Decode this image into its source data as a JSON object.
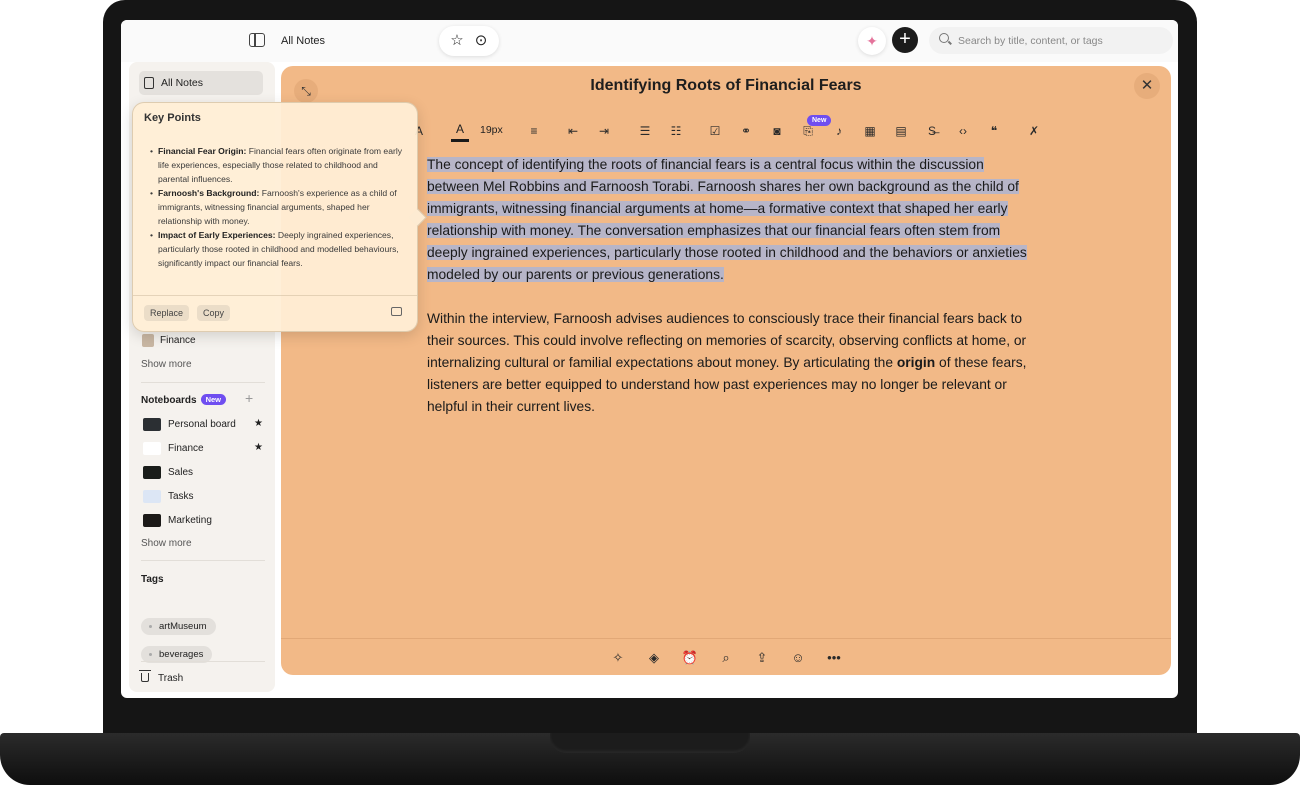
{
  "topbar": {
    "title": "All Notes",
    "search_placeholder": "Search by title, content, or tags",
    "plus_glyph": "+"
  },
  "sidebar": {
    "all_notes": "All Notes",
    "finance_note": "Finance",
    "show_more": "Show more",
    "noteboards_heading": "Noteboards",
    "new_badge": "New",
    "noteboards": [
      {
        "name": "Personal board",
        "starred": true,
        "thumb_color": "#2b2f33"
      },
      {
        "name": "Finance",
        "starred": true,
        "thumb_color": "#ffffff"
      },
      {
        "name": "Sales",
        "starred": false,
        "thumb_color": "#1a1d1a"
      },
      {
        "name": "Tasks",
        "starred": false,
        "thumb_color": "#dce6f5"
      },
      {
        "name": "Marketing",
        "starred": false,
        "thumb_color": "#1c1a18"
      }
    ],
    "show_more_2": "Show more",
    "tags_heading": "Tags",
    "tags": [
      "artMuseum",
      "beverages"
    ],
    "trash": "Trash"
  },
  "key_points": {
    "title": "Key Points",
    "items": [
      {
        "heading": "Financial Fear Origin:",
        "text": " Financial fears often originate from early life experiences, especially those related to childhood and parental influences."
      },
      {
        "heading": "Farnoosh's Background:",
        "text": " Farnoosh's experience as a child of immigrants, witnessing financial arguments, shaped her relationship with money."
      },
      {
        "heading": "Impact of Early Experiences:",
        "text": " Deeply ingrained experiences, particularly those rooted in childhood and modelled behaviours, significantly impact our financial fears."
      }
    ],
    "replace_label": "Replace",
    "copy_label": "Copy"
  },
  "note": {
    "title": "Identifying Roots of Financial Fears",
    "font_size": "19px",
    "new_badge": "New",
    "paragraph1": "The concept of identifying the roots of financial fears is a central focus within the discussion between Mel Robbins and Farnoosh Torabi. Farnoosh shares her own background as the child of immigrants, witnessing financial arguments at home—a formative context that shaped her early relationship with money. The conversation emphasizes that our financial fears often stem from deeply ingrained experiences, particularly those rooted in childhood and the behaviors or anxieties modeled by our parents or previous generations.",
    "paragraph2_before": "Within the interview, Farnoosh advises audiences to consciously trace their financial fears back to their sources. This could involve reflecting on memories of scarcity, observing conflicts at home, or internalizing cultural or familial expectations about money. By articulating the ",
    "paragraph2_bold": "origin",
    "paragraph2_after": " of these fears, listeners are better equipped to understand how past experiences may no longer be relevant or helpful in their current lives."
  },
  "colors": {
    "note_background": "#f2b987",
    "selection_highlight": "#b7b5c8",
    "accent_badge": "#6f4ef0"
  }
}
